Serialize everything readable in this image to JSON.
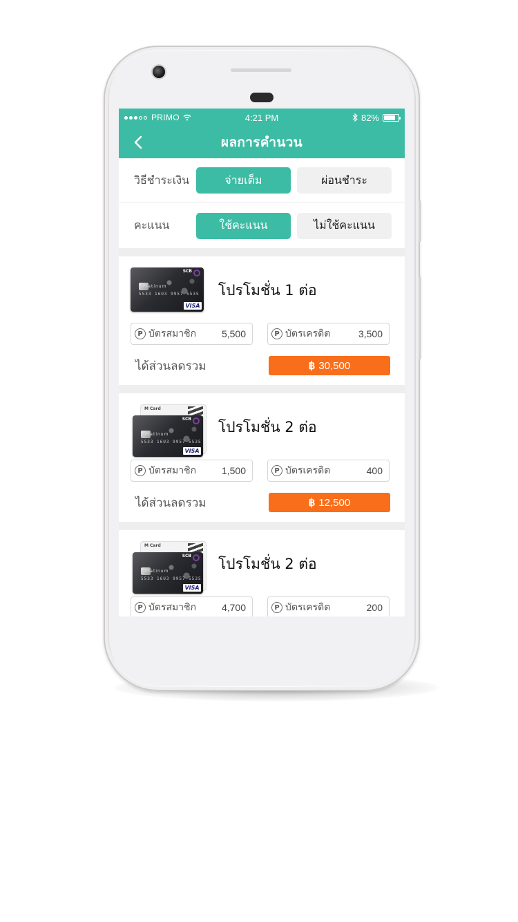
{
  "status_bar": {
    "carrier": "PRIMO",
    "time": "4:21 PM",
    "battery": "82%",
    "battery_level": 0.82
  },
  "navbar": {
    "title": "ผลการคำนวน",
    "back_icon": "chevron-left-icon"
  },
  "payment": {
    "label": "วิธีชำระเงิน",
    "options": [
      "จ่ายเต็ม",
      "ผ่อนชำระ"
    ],
    "selected": "จ่ายเต็ม"
  },
  "points": {
    "label": "คะแนน",
    "options": [
      "ใช้คะแนน",
      "ไม่ใช้คะแนน"
    ],
    "selected": "ใช้คะแนน"
  },
  "promos": [
    {
      "title": "โปรโมชั่น 1 ต่อ",
      "member_label": "บัตรสมาชิก",
      "member_points": "5,500",
      "credit_label": "บัตรเครดิต",
      "credit_points": "3,500",
      "discount_label": "ได้ส่วนลดรวม",
      "discount_currency": "฿",
      "discount_value": "30,500"
    },
    {
      "title": "โปรโมชั่น 2 ต่อ",
      "member_label": "บัตรสมาชิก",
      "member_points": "1,500",
      "credit_label": "บัตรเครดิต",
      "credit_points": "400",
      "discount_label": "ได้ส่วนลดรวม",
      "discount_currency": "฿",
      "discount_value": "12,500"
    },
    {
      "title": "โปรโมชั่น 2 ต่อ",
      "member_label": "บัตรสมาชิก",
      "member_points": "4,700",
      "credit_label": "บัตรเครดิต",
      "credit_points": "200"
    }
  ],
  "card_art": {
    "brand": "SCB",
    "tier": "Platinum",
    "network": "VISA",
    "number": "5533 16U3 9957 5535",
    "member_card": "M Card"
  },
  "colors": {
    "primary": "#3dbca5",
    "accent": "#f96e1b"
  }
}
